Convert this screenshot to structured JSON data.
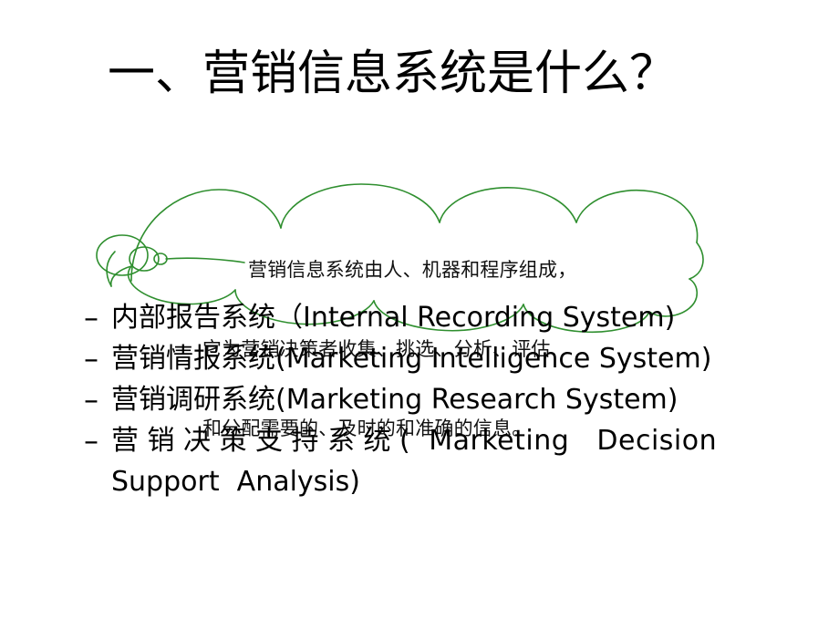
{
  "slide": {
    "background_color": "#ffffff",
    "text_color": "#000000",
    "callout_color": "#2f8f2f"
  },
  "title": {
    "text": "一、营销信息系统是什么？"
  },
  "callout": {
    "shape": "cloud-callout",
    "tail_direction": "left",
    "outline_color": "#2f8f2f",
    "lines": [
      "营销信息系统由人、机器和程序组成，",
      "它为营销决策者收集、挑选、分析、评估",
      "和分配需要的、及时的和准确的信息。"
    ]
  },
  "bullets": [
    {
      "dash": "–",
      "cn": "内部报告系统（",
      "en": "Internal Recording System)",
      "justified": false,
      "wrap": ""
    },
    {
      "dash": "–",
      "cn": "营销情报系统",
      "en": "(Marketing Intelligence System)",
      "justified": false,
      "wrap": ""
    },
    {
      "dash": "–",
      "cn": "营销调研系统",
      "en": "(Marketing Research System)",
      "justified": false,
      "wrap": ""
    },
    {
      "dash": "–",
      "cn": "营销决策支持系统",
      "en": "(  Marketing   Decision",
      "justified": true,
      "wrap": "Support  Analysis)"
    }
  ]
}
